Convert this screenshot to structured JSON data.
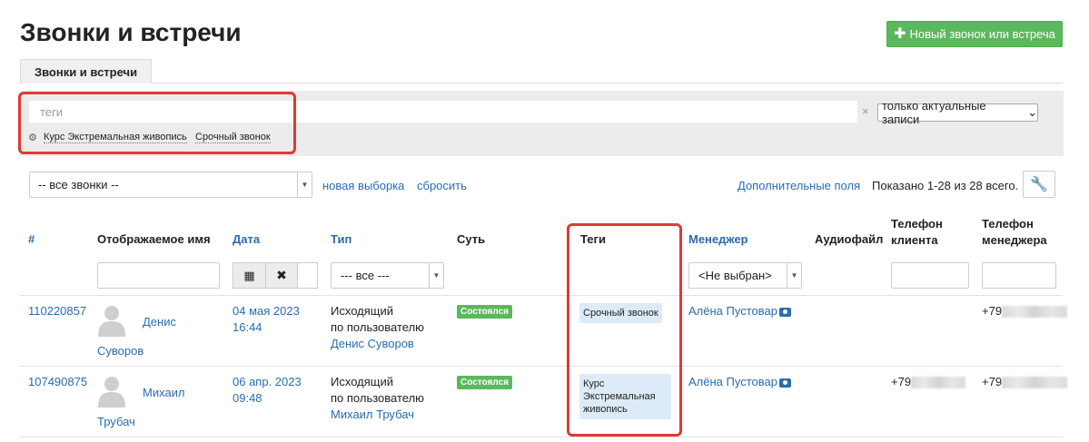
{
  "page": {
    "title": "Звонки и встречи",
    "new_button_icon": "plus-icon",
    "new_button_label": "Новый звонок или встреча",
    "tab_active": "Звонки и встречи"
  },
  "filter": {
    "tags_placeholder": "теги",
    "clear": "×",
    "actual_select": "только актуальные записи",
    "tag_suggestions": [
      "Курс Экстремальная живопись",
      "Срочный звонок"
    ],
    "calls_select": "-- все звонки --",
    "new_selection": "новая выборка",
    "reset": "сбросить",
    "extra_fields": "Дополнительные поля",
    "shown": "Показано 1-28 из 28 всего."
  },
  "table": {
    "headers": {
      "id": "#",
      "name": "Отображаемое имя",
      "date": "Дата",
      "type": "Тип",
      "essence": "Суть",
      "tags": "Теги",
      "manager": "Менеджер",
      "audio": "Аудиофайл",
      "client_phone_1": "Телефон",
      "client_phone_2": "клиента",
      "manager_phone_1": "Телефон",
      "manager_phone_2": "менеджера"
    },
    "type_filter": "--- все ---",
    "manager_filter": "<Не выбран>",
    "rows": [
      {
        "id": "110220857",
        "name_first": "Денис",
        "name_last": "Суворов",
        "date": "04 мая 2023",
        "time": "16:44",
        "type_1": "Исходящий",
        "type_2": "по пользователю",
        "type_user": "Денис Суворов",
        "status": "Состоялся",
        "tags": "Срочный звонок",
        "manager": "Алёна Пустовар",
        "client_phone": "",
        "manager_phone": "+79"
      },
      {
        "id": "107490875",
        "name_first": "Михаил",
        "name_last": "Трубач",
        "date": "06 апр. 2023",
        "time": "09:48",
        "type_1": "Исходящий",
        "type_2": "по пользователю",
        "type_user": "Михаил Трубач",
        "status": "Состоялся",
        "tags": "Курс Экстремальная живопись",
        "manager": "Алёна Пустовар",
        "client_phone": "+79",
        "manager_phone": "+79"
      }
    ]
  }
}
